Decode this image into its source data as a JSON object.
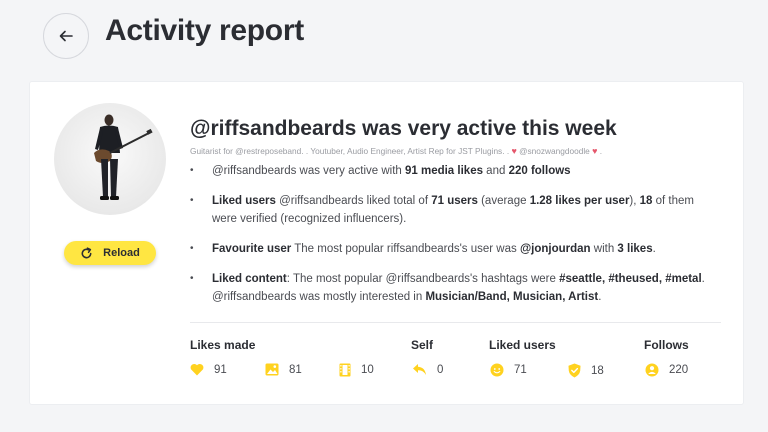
{
  "header": {
    "title": "Activity report"
  },
  "profile": {
    "reload_label": "Reload",
    "headline": "@riffsandbeards was very active this week",
    "bio_prefix": "Guitarist for @restreposeband. . Youtuber, Audio Engineer, Artist Rep for JST Plugins. .",
    "bio_mention": "@snozwangdoodle",
    "bio_suffix": "."
  },
  "bullets": {
    "b1": {
      "t1": "@riffsandbeards was very active with ",
      "v1": "91 media likes",
      "t2": " and ",
      "v2": "220 follows"
    },
    "b2": {
      "label": "Liked users",
      "t1": " @riffsandbeards liked total of ",
      "v1": "71 users",
      "t2": " (average ",
      "v2": "1.28 likes per user",
      "t3": "), ",
      "v3": "18",
      "t4": " of them were verified (recognized influencers)."
    },
    "b3": {
      "label": "Favourite user",
      "t1": " The most popular riffsandbeards's user was ",
      "v1": "@jonjourdan",
      "t2": " with ",
      "v2": "3 likes",
      "t3": "."
    },
    "b4": {
      "label": "Liked content",
      "t1": ": The most popular @riffsandbeards's hashtags were ",
      "v1": "#seattle, #theused, #metal",
      "t2": ". @riffsandbeards was mostly interested in ",
      "v2": "Musician/Band, Musician, Artist",
      "t3": "."
    }
  },
  "stats": {
    "headers": {
      "likes_made": "Likes made",
      "self": "Self",
      "liked_users": "Liked users",
      "follows": "Follows"
    },
    "values": {
      "likes": "91",
      "photos": "81",
      "videos": "10",
      "self": "0",
      "liked_users": "71",
      "verified": "18",
      "follows": "220"
    }
  },
  "colors": {
    "accent": "#ffe642",
    "icon": "#ffd21f",
    "heart": "#e5566b",
    "text": "#2b2d33"
  }
}
